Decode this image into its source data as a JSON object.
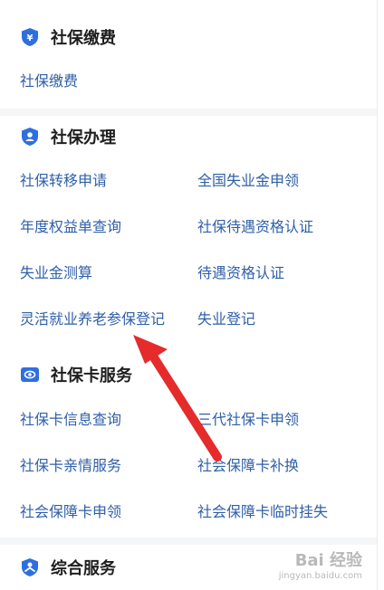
{
  "sections": [
    {
      "title": "社保缴费",
      "icon": "yuan-shield-icon",
      "items": [
        "社保缴费"
      ]
    },
    {
      "title": "社保办理",
      "icon": "person-shield-icon",
      "items": [
        "社保转移申请",
        "全国失业金申领",
        "年度权益单查询",
        "社保待遇资格认证",
        "失业金测算",
        "待遇资格认证",
        "灵活就业养老参保登记",
        "失业登记"
      ]
    },
    {
      "title": "社保卡服务",
      "icon": "card-icon",
      "items": [
        "社保卡信息查询",
        "三代社保卡申领",
        "社保卡亲情服务",
        "社会保障卡补换",
        "社会保障卡申领",
        "社会保障卡临时挂失"
      ]
    },
    {
      "title": "综合服务",
      "icon": "person-service-icon",
      "items": []
    }
  ],
  "watermark": {
    "logo": "Bai 经验",
    "sub": "jingyan.baidu.com"
  },
  "colors": {
    "link": "#2f5fa8",
    "icon": "#2e6fe0",
    "arrow": "#e52b2b"
  }
}
